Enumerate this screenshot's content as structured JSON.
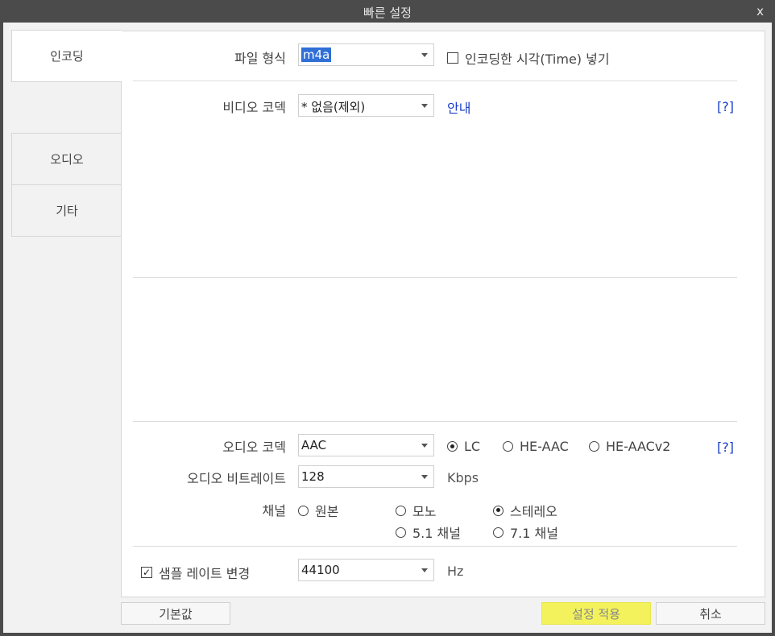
{
  "window": {
    "title": "빠른 설정",
    "close_label": "x"
  },
  "sidebar": {
    "items": [
      {
        "label": "인코딩",
        "active": true
      },
      {
        "label": "오디오",
        "active": false
      },
      {
        "label": "기타",
        "active": false
      }
    ]
  },
  "encoding": {
    "file_format": {
      "label": "파일 형식",
      "value": "m4a"
    },
    "insert_time": {
      "label": "인코딩한 시각(Time) 넣기",
      "checked": false
    },
    "video_codec": {
      "label": "비디오 코덱",
      "value": "* 없음(제외)",
      "guide_link": "안내",
      "help": "[?]"
    },
    "audio_codec": {
      "label": "오디오 코덱",
      "value": "AAC",
      "help": "[?]",
      "profiles": [
        {
          "label": "LC",
          "selected": true
        },
        {
          "label": "HE-AAC",
          "selected": false
        },
        {
          "label": "HE-AACv2",
          "selected": false
        }
      ]
    },
    "audio_bitrate": {
      "label": "오디오 비트레이트",
      "value": "128",
      "unit": "Kbps"
    },
    "channel": {
      "label": "채널",
      "options": [
        {
          "label": "원본",
          "selected": false
        },
        {
          "label": "모노",
          "selected": false
        },
        {
          "label": "스테레오",
          "selected": true
        },
        {
          "label": "5.1 채널",
          "selected": false
        },
        {
          "label": "7.1 채널",
          "selected": false
        }
      ]
    },
    "sample_rate": {
      "label": "샘플 레이트 변경",
      "checked": true,
      "value": "44100",
      "unit": "Hz"
    }
  },
  "footer": {
    "defaults": "기본값",
    "apply": "설정 적용",
    "cancel": "취소"
  }
}
